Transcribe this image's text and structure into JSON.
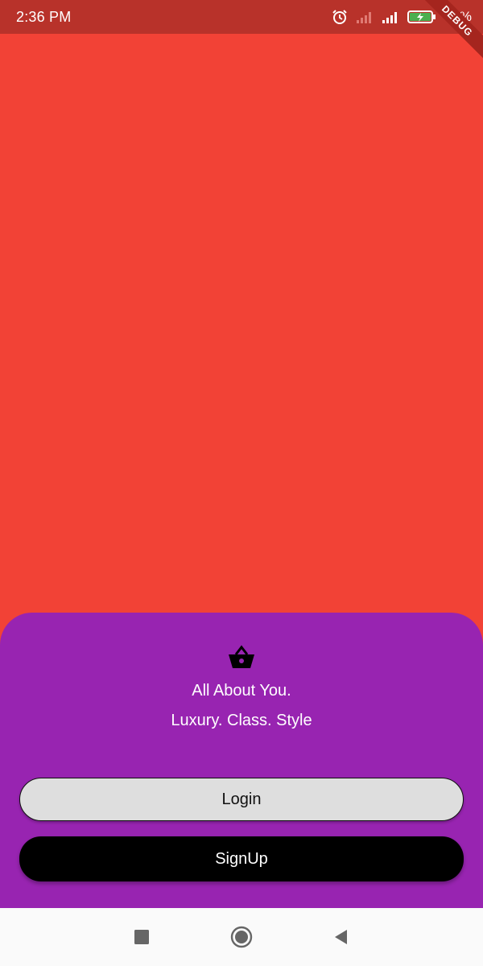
{
  "status_bar": {
    "time": "2:36 PM",
    "battery_percent": "96%",
    "icons": [
      "alarm-icon",
      "signal-weak-icon",
      "signal-icon",
      "battery-charging-icon"
    ],
    "background": "#b8322a"
  },
  "debug_banner": {
    "label": "DEBUG"
  },
  "screen": {
    "background": "#f24236"
  },
  "sheet": {
    "background": "#9824b1",
    "icon": "shopping-basket-icon",
    "tagline_1": "All About You.",
    "tagline_2": "Luxury. Class. Style",
    "login_label": "Login",
    "signup_label": "SignUp"
  },
  "nav_bar": {
    "icons": [
      "recents-square-icon",
      "home-circle-icon",
      "back-triangle-icon"
    ]
  }
}
